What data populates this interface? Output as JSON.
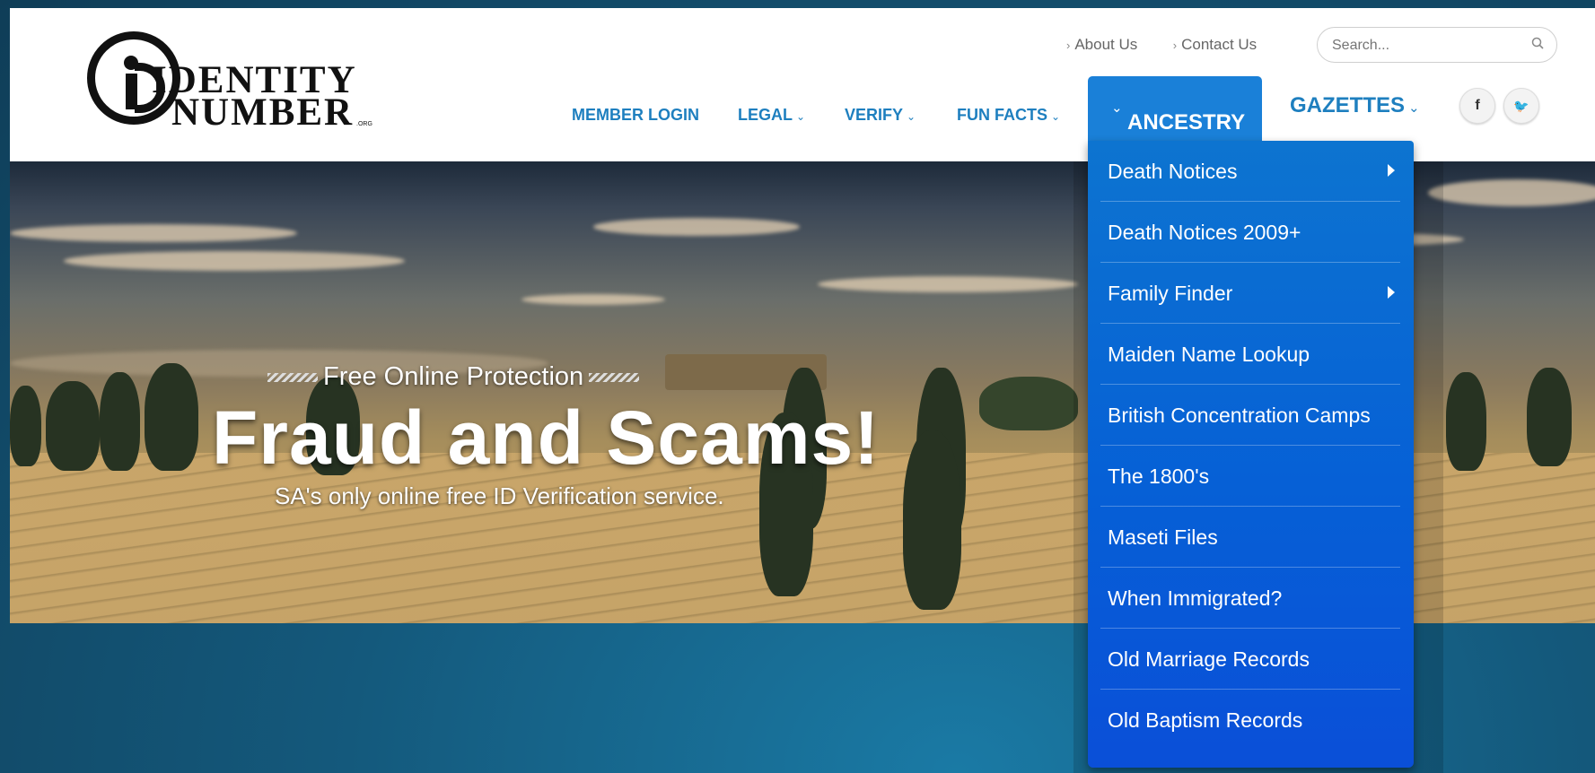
{
  "logo": {
    "line1": "IDENTITY",
    "line2": "NUMBER",
    "suffix": ".ORG"
  },
  "toplinks": [
    {
      "label": "About Us"
    },
    {
      "label": "Contact Us"
    }
  ],
  "search": {
    "placeholder": "Search..."
  },
  "nav": {
    "member_login": "MEMBER LOGIN",
    "legal": "LEGAL",
    "verify": "VERIFY",
    "fun_facts": "FUN FACTS",
    "ancestry": "ANCESTRY",
    "gazettes": "GAZETTES"
  },
  "social": {
    "facebook": "f",
    "twitter": "🐦"
  },
  "hero": {
    "kicker": "Free Online Protection",
    "title": "Fraud and Scams!",
    "subtitle": "SA's only online free ID Verification service."
  },
  "dropdown": {
    "items": [
      {
        "label": "Death Notices",
        "has_submenu": true
      },
      {
        "label": "Death Notices 2009+",
        "has_submenu": false
      },
      {
        "label": "Family Finder",
        "has_submenu": true
      },
      {
        "label": "Maiden Name Lookup",
        "has_submenu": false
      },
      {
        "label": "British Concentration Camps",
        "has_submenu": false
      },
      {
        "label": "The 1800's",
        "has_submenu": false
      },
      {
        "label": "Maseti Files",
        "has_submenu": false
      },
      {
        "label": "When Immigrated?",
        "has_submenu": false
      },
      {
        "label": "Old Marriage Records",
        "has_submenu": false
      },
      {
        "label": "Old Baptism Records",
        "has_submenu": false
      }
    ]
  },
  "colors": {
    "nav_link": "#1e7fbf",
    "dropdown_bg": "#0660d6",
    "page_bg": "#14597c"
  }
}
